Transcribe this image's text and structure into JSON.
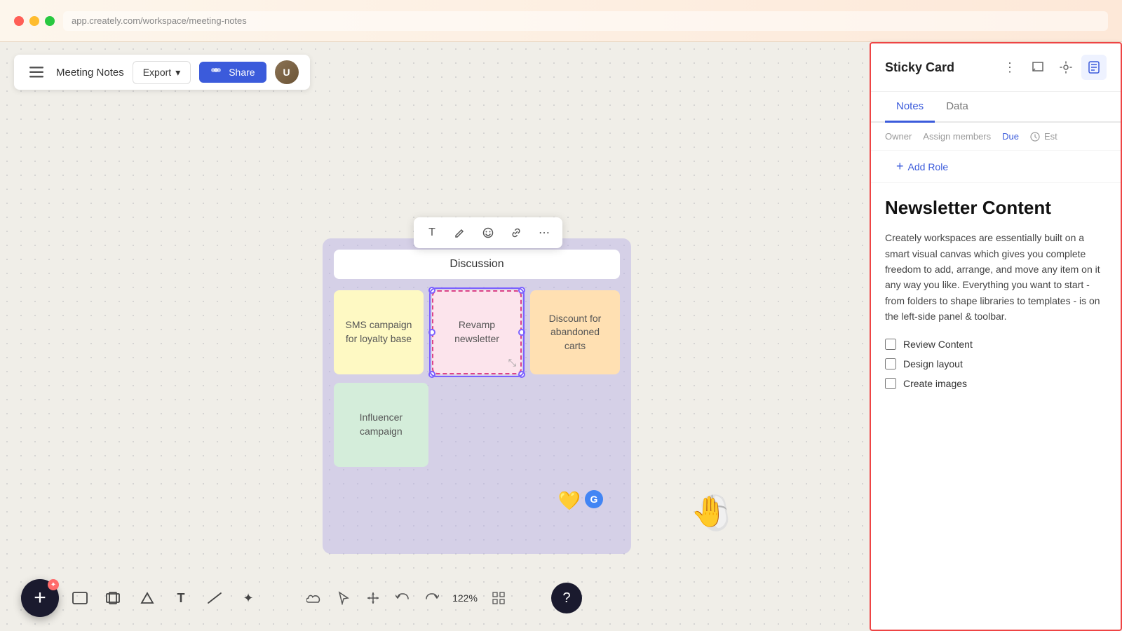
{
  "titlebar": {
    "url_placeholder": "app.creately.com/workspace/meeting-notes"
  },
  "canvas": {
    "title": "Meeting Notes",
    "export_label": "Export",
    "share_label": "Share",
    "zoom_level": "122%"
  },
  "discussion_group": {
    "header": "Discussion",
    "cards": [
      {
        "id": "sms",
        "text": "SMS campaign for loyalty base",
        "type": "yellow"
      },
      {
        "id": "revamp",
        "text": "Revamp newsletter",
        "type": "pink",
        "selected": true
      },
      {
        "id": "discount",
        "text": "Discount for abandoned carts",
        "type": "orange"
      },
      {
        "id": "influencer",
        "text": "Influencer campaign",
        "type": "green"
      }
    ]
  },
  "right_panel": {
    "title": "Sticky Card",
    "tabs": [
      {
        "id": "notes",
        "label": "Notes",
        "active": true
      },
      {
        "id": "data",
        "label": "Data",
        "active": false
      }
    ],
    "fields": {
      "owner_label": "Owner",
      "assign_label": "Assign members",
      "due_label": "Due",
      "est_label": "Est",
      "add_role_label": "Add Role"
    },
    "content": {
      "title": "Newsletter Content",
      "description": "Creately workspaces are essentially built on a smart visual canvas which gives you complete freedom to add, arrange, and move any item on it any way you like. Everything you want to start - from folders to shape libraries to templates - is on the left-side panel & toolbar.",
      "checklist": [
        {
          "id": "review",
          "label": "Review Content",
          "checked": false
        },
        {
          "id": "design",
          "label": "Design layout",
          "checked": false
        },
        {
          "id": "images",
          "label": "Create images",
          "checked": false
        }
      ]
    },
    "icons": {
      "chat": "💬",
      "settings": "⚙",
      "notes": "📋",
      "more": "⋮"
    }
  },
  "bottom_toolbar": {
    "zoom_label": "122%",
    "tools": [
      "▭",
      "▱",
      "⬡",
      "T",
      "╲",
      "✦"
    ]
  },
  "floating_toolbar": {
    "tools": [
      "T",
      "✏",
      "😊",
      "🔗",
      "⋮"
    ]
  }
}
